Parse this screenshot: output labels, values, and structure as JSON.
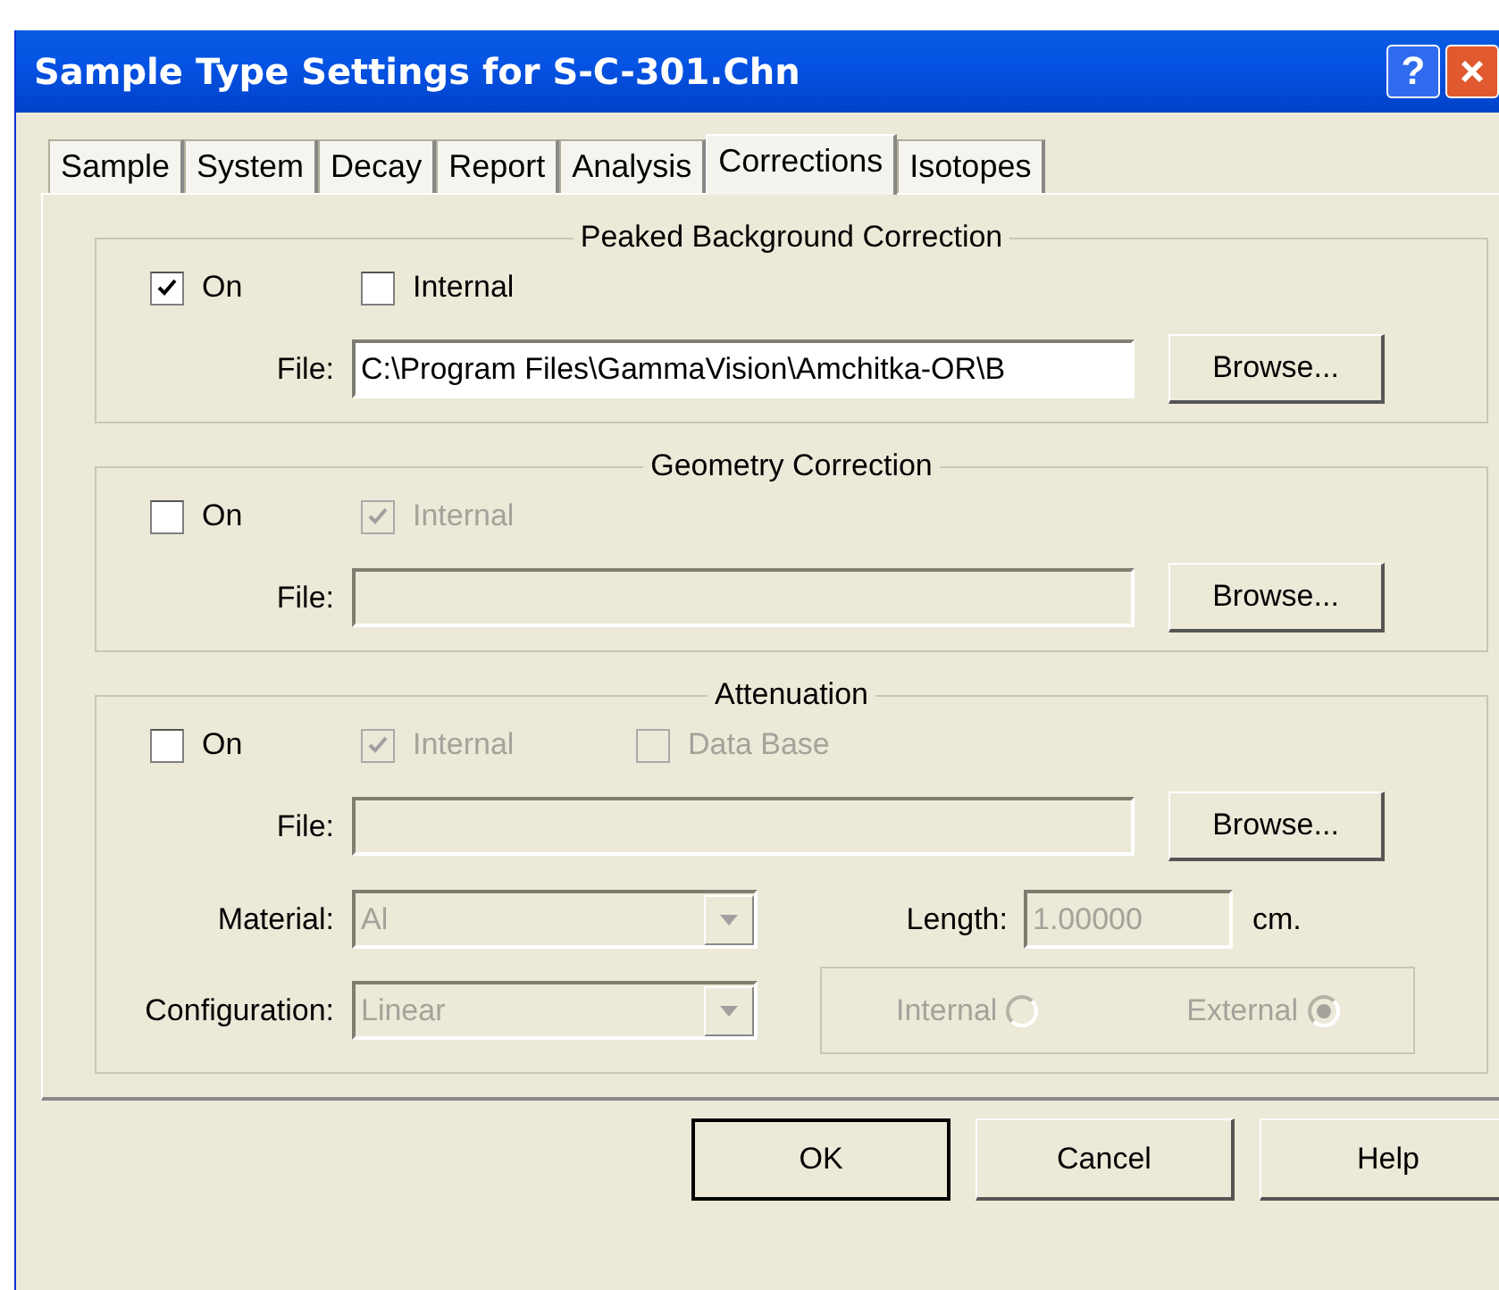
{
  "window": {
    "title": "Sample Type Settings for S-C-301.Chn",
    "help_button": "?"
  },
  "tabs": [
    {
      "label": "Sample",
      "selected": false
    },
    {
      "label": "System",
      "selected": false
    },
    {
      "label": "Decay",
      "selected": false
    },
    {
      "label": "Report",
      "selected": false
    },
    {
      "label": "Analysis",
      "selected": false
    },
    {
      "label": "Corrections",
      "selected": true
    },
    {
      "label": "Isotopes",
      "selected": false
    }
  ],
  "groups": [
    {
      "title": "Peaked Background Correction",
      "checkboxes": [
        {
          "label": "On",
          "checked": true,
          "disabled": false
        },
        {
          "label": "Internal",
          "checked": false,
          "disabled": false
        }
      ],
      "file": {
        "label": "File:",
        "value": "C:\\Program Files\\GammaVision\\Amchitka-OR\\B",
        "disabled": false
      },
      "browse": "Browse..."
    },
    {
      "title": "Geometry Correction",
      "checkboxes": [
        {
          "label": "On",
          "checked": false,
          "disabled": false
        },
        {
          "label": "Internal",
          "checked": true,
          "disabled": true
        }
      ],
      "file": {
        "label": "File:",
        "disabled": true
      },
      "browse": "Browse..."
    },
    {
      "title": "Attenuation",
      "checkboxes": [
        {
          "label": "On",
          "checked": false,
          "disabled": false
        },
        {
          "label": "Internal",
          "checked": true,
          "disabled": true
        },
        {
          "label": "Data Base",
          "checked": false,
          "disabled": true
        }
      ],
      "file": {
        "label": "File:",
        "disabled": true
      },
      "browse": "Browse...",
      "material": {
        "label": "Material:",
        "value": "Al",
        "disabled": true
      },
      "length": {
        "label": "Length:",
        "value": "1.00000",
        "unit": "cm.",
        "disabled": true
      },
      "configuration": {
        "label": "Configuration:",
        "value": "Linear",
        "disabled": true
      },
      "radios": [
        {
          "label": "Internal",
          "selected": false,
          "disabled": true
        },
        {
          "label": "External",
          "selected": true,
          "disabled": true
        }
      ]
    }
  ],
  "buttons": [
    {
      "label": "OK",
      "default": true
    },
    {
      "label": "Cancel",
      "default": false
    },
    {
      "label": "Help",
      "default": false
    }
  ]
}
